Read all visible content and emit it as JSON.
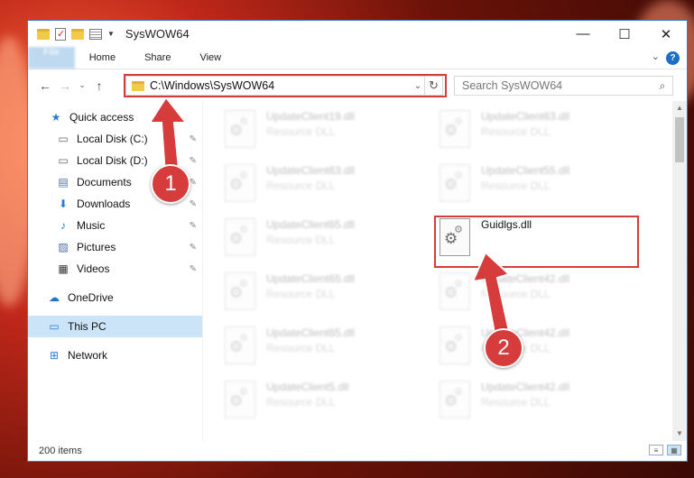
{
  "window": {
    "title": "SysWOW64"
  },
  "titlebar": {
    "minimize": "—",
    "maximize": "☐",
    "close": "✕"
  },
  "ribbon": {
    "tabs": [
      "File",
      "Home",
      "Share",
      "View"
    ],
    "help": "?"
  },
  "nav": {
    "back": "←",
    "forward": "→",
    "recent": "⌄",
    "up": "↑"
  },
  "address": {
    "path": "C:\\Windows\\SysWOW64"
  },
  "search": {
    "placeholder": "Search SysWOW64"
  },
  "sidebar": {
    "items": [
      {
        "label": "Quick access",
        "icon": "★"
      },
      {
        "label": "Local Disk (C:)",
        "icon": "▭"
      },
      {
        "label": "Local Disk (D:)",
        "icon": "▭"
      },
      {
        "label": "Documents",
        "icon": "▤"
      },
      {
        "label": "Downloads",
        "icon": "⬇"
      },
      {
        "label": "Music",
        "icon": "♪"
      },
      {
        "label": "Pictures",
        "icon": "▨"
      },
      {
        "label": "Videos",
        "icon": "▦"
      },
      {
        "label": "OneDrive",
        "icon": "☁"
      },
      {
        "label": "This PC",
        "icon": "▭"
      },
      {
        "label": "Network",
        "icon": "⊞"
      }
    ],
    "pin": "📌"
  },
  "files": [
    {
      "name": "UpdateClient19.dll",
      "type": "Resource DLL"
    },
    {
      "name": "UpdateClient63.dll",
      "type": "Resource DLL"
    },
    {
      "name": "UpdateClient63.dll",
      "type": "Resource DLL"
    },
    {
      "name": "UpdateClient55.dll",
      "type": "Resource DLL"
    },
    {
      "name": "UpdateClient65.dll",
      "type": "Resource DLL"
    },
    {
      "name": "Guidlgs.dll",
      "type": ""
    },
    {
      "name": "UpdateClient65.dll",
      "type": "Resource DLL"
    },
    {
      "name": "UpdateClient42.dll",
      "type": "Resource DLL"
    },
    {
      "name": "UpdateClient65.dll",
      "type": "Resource DLL"
    },
    {
      "name": "UpdateClient42.dll",
      "type": "Resource DLL"
    },
    {
      "name": "UpdateClient5.dll",
      "type": "Resource DLL"
    },
    {
      "name": "UpdateClient42.dll",
      "type": "Resource DLL"
    }
  ],
  "status": {
    "count": "200 items"
  },
  "callouts": {
    "one": "1",
    "two": "2"
  },
  "colors": {
    "accent": "#1979ca",
    "callout": "#d63c3c",
    "selection": "#cce4f7"
  }
}
